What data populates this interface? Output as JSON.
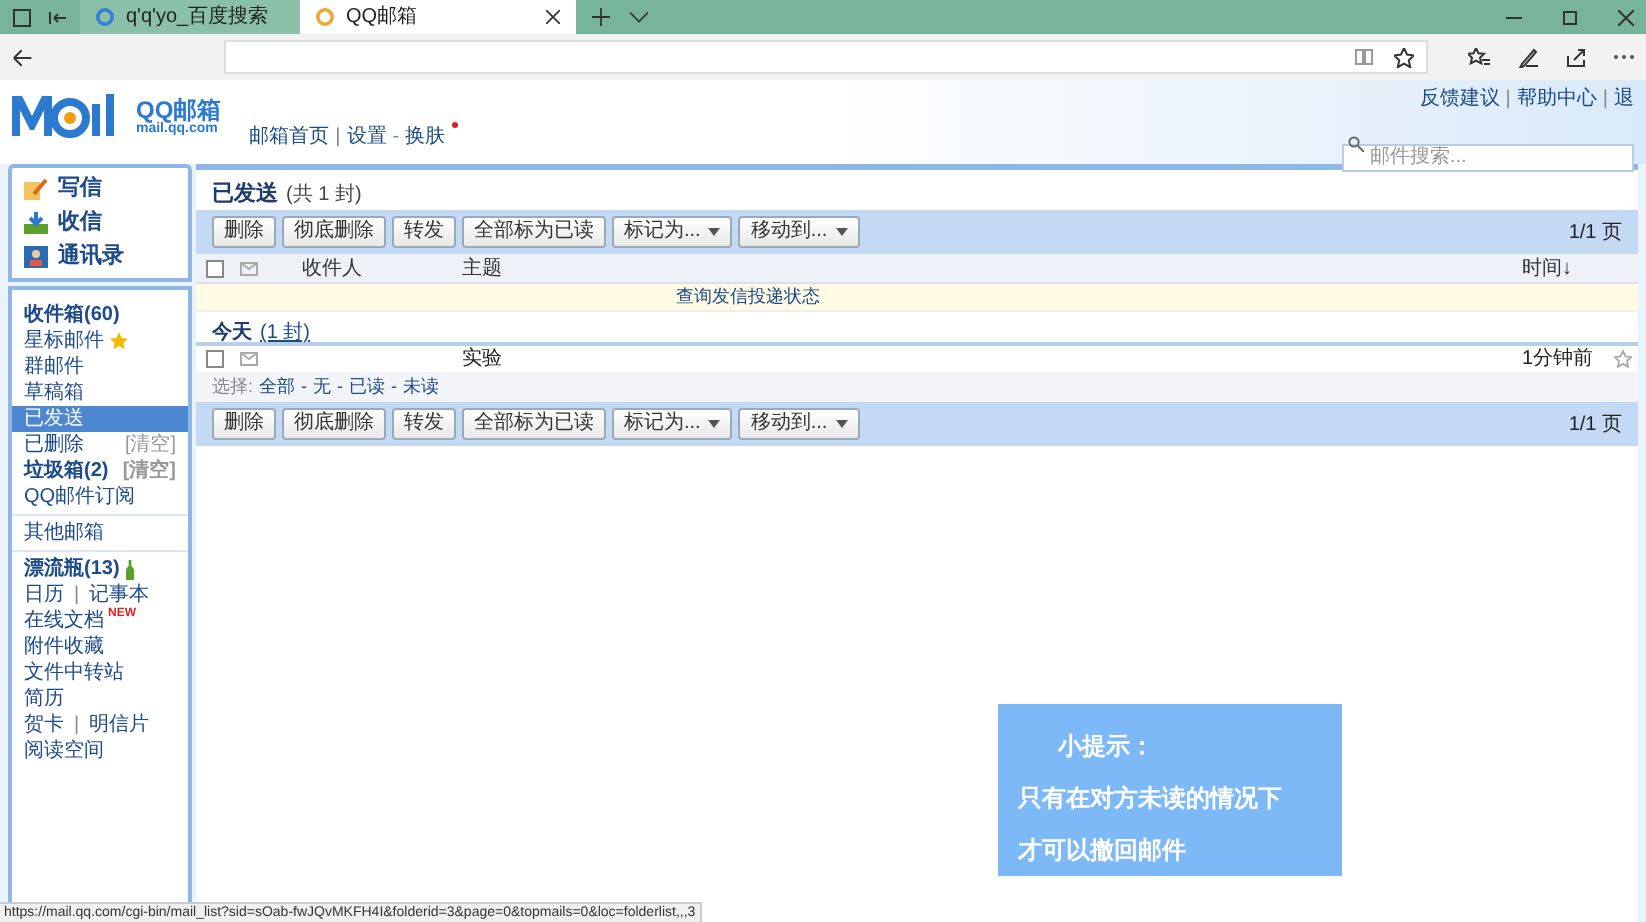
{
  "browser": {
    "tabs": [
      {
        "title": "q'q'yo_百度搜索",
        "selected": false
      },
      {
        "title": "QQ邮箱",
        "selected": true
      }
    ],
    "status_url": "https://mail.qq.com/cgi-bin/mail_list?sid=sOab-fwJQvMKFH4I&folderid=3&page=0&topmails=0&loc=folderlist,,,3"
  },
  "header": {
    "logo_text": "QQ邮箱",
    "logo_domain": "mail.qq.com",
    "nav_links": [
      {
        "text": "邮箱首页",
        "kind": "link"
      },
      {
        "text": "|",
        "kind": "separator"
      },
      {
        "text": "设置",
        "kind": "link"
      },
      {
        "text": "-",
        "kind": "separator"
      },
      {
        "text": "换肤",
        "kind": "link"
      }
    ],
    "top_links": [
      {
        "text": "反馈建议",
        "kind": "link"
      },
      {
        "text": "|",
        "kind": "separator"
      },
      {
        "text": "帮助中心",
        "kind": "link"
      },
      {
        "text": "|",
        "kind": "separator"
      },
      {
        "text": "退",
        "kind": "link"
      }
    ],
    "search": {
      "placeholder": "邮件搜索..."
    }
  },
  "sidebar": {
    "actions": [
      {
        "label": "写信",
        "kind": "write"
      },
      {
        "label": "收信",
        "kind": "receive"
      },
      {
        "label": "通讯录",
        "kind": "contacts"
      }
    ],
    "groups": [
      [
        {
          "labels": [
            "收件箱(60)"
          ],
          "unread": true,
          "selected": false
        },
        {
          "labels": [
            "星标邮件"
          ],
          "unread": false,
          "selected": false,
          "kind": "starred"
        },
        {
          "labels": [
            "群邮件"
          ],
          "unread": false,
          "selected": false
        },
        {
          "labels": [
            "草稿箱"
          ],
          "unread": false,
          "selected": false
        },
        {
          "labels": [
            "已发送"
          ],
          "unread": false,
          "selected": true
        },
        {
          "labels": [
            "已删除"
          ],
          "unread": false,
          "selected": false,
          "action": "[清空]"
        },
        {
          "labels": [
            "垃圾箱(2)"
          ],
          "unread": true,
          "selected": false,
          "action": "[清空]"
        },
        {
          "labels": [
            "QQ邮件订阅"
          ],
          "unread": false,
          "selected": false
        }
      ],
      [
        {
          "labels": [
            "其他邮箱"
          ],
          "unread": false,
          "selected": false
        }
      ],
      [
        {
          "labels": [
            "漂流瓶(13)"
          ],
          "unread": true,
          "selected": false,
          "kind": "bottle"
        },
        {
          "labels": [
            "日历",
            "|",
            "记事本"
          ],
          "unread": false,
          "selected": false
        },
        {
          "labels": [
            "在线文档"
          ],
          "unread": false,
          "selected": false,
          "tag": "NEW"
        },
        {
          "labels": [
            "附件收藏"
          ],
          "unread": false,
          "selected": false
        },
        {
          "labels": [
            "文件中转站"
          ],
          "unread": false,
          "selected": false
        },
        {
          "labels": [
            "简历"
          ],
          "unread": false,
          "selected": false
        },
        {
          "labels": [
            "贺卡",
            "|",
            "明信片"
          ],
          "unread": false,
          "selected": false
        },
        {
          "labels": [
            "阅读空间"
          ],
          "unread": false,
          "selected": false
        }
      ]
    ]
  },
  "content": {
    "title": "已发送",
    "count": "(共 1 封)",
    "toolbars": [
      {
        "buttons": [
          {
            "label": "删除",
            "dropdown": false
          },
          {
            "label": "彻底删除",
            "dropdown": false
          },
          {
            "label": "转发",
            "dropdown": false
          },
          {
            "label": "全部标为已读",
            "dropdown": false
          },
          {
            "label": "标记为...",
            "dropdown": true
          },
          {
            "label": "移动到...",
            "dropdown": true
          }
        ],
        "pager": "1/1 页"
      },
      {
        "buttons": [
          {
            "label": "删除",
            "dropdown": false
          },
          {
            "label": "彻底删除",
            "dropdown": false
          },
          {
            "label": "转发",
            "dropdown": false
          },
          {
            "label": "全部标为已读",
            "dropdown": false
          },
          {
            "label": "标记为...",
            "dropdown": true
          },
          {
            "label": "移动到...",
            "dropdown": true
          }
        ],
        "pager": "1/1 页"
      }
    ],
    "header_checked": false,
    "columns": [
      "收件人",
      "主题",
      "时间↓"
    ],
    "notice": "查询发信投递状态",
    "group": {
      "title": "今天",
      "count": "(1 封)"
    },
    "rows": [
      {
        "subject": "实验",
        "time": "1分钟前",
        "checked": false,
        "starred": false
      }
    ],
    "select_bar": {
      "label": "选择:",
      "options": [
        "全部",
        "-",
        "无",
        "-",
        "已读",
        "-",
        "未读"
      ]
    }
  },
  "tip": {
    "title": "小提示：",
    "lines": [
      "只有在对方未读的情况下",
      "才可以撤回邮件"
    ]
  }
}
